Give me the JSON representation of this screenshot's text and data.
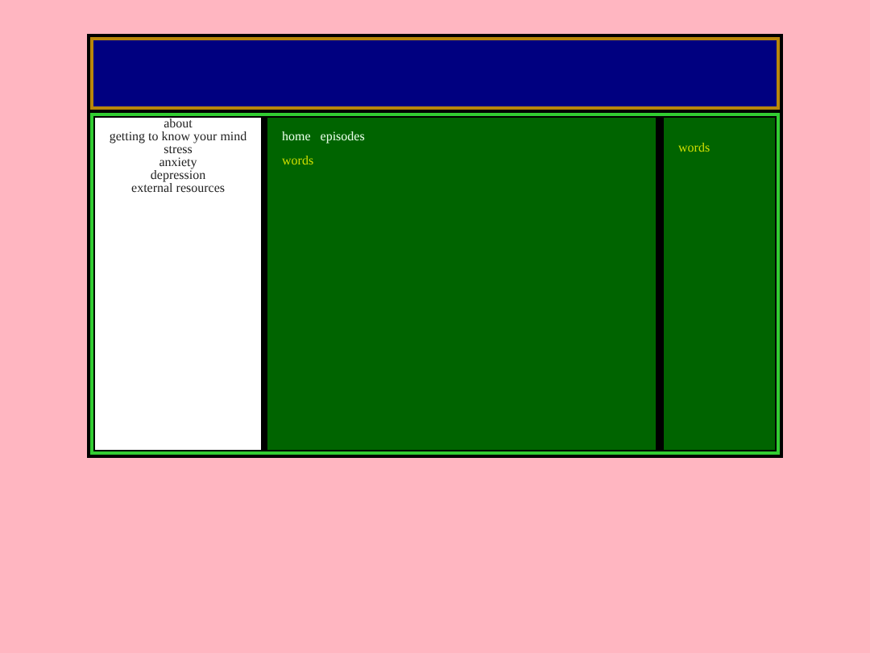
{
  "sidebar": {
    "items": [
      "about",
      "getting to know your mind",
      "stress",
      "anxiety",
      "depression",
      "external resources"
    ]
  },
  "nav": {
    "links": [
      "home",
      "episodes"
    ]
  },
  "main": {
    "text": "words"
  },
  "aside": {
    "text": "words"
  }
}
